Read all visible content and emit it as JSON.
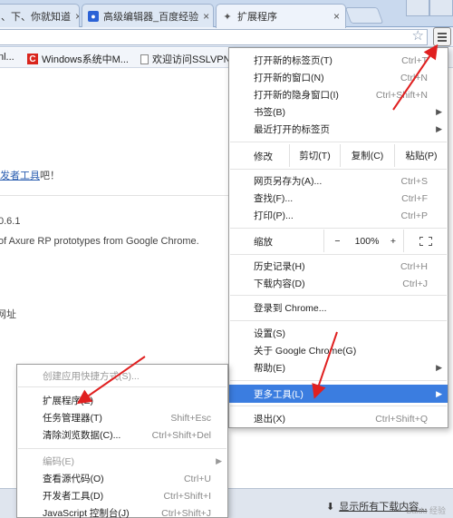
{
  "tabs": [
    {
      "label": "、下、你就知道",
      "active": false
    },
    {
      "label": "高级编辑器_百度经验",
      "active": false
    },
    {
      "label": "扩展程序",
      "active": true
    }
  ],
  "tab_close": "×",
  "bookmarks": [
    {
      "label": "nl..."
    },
    {
      "label": "Windows系统中M..."
    },
    {
      "label": "欢迎访问SSLVPN"
    }
  ],
  "page": {
    "line1_link": "发者工具",
    "line1_tail": "吧！",
    "version": "0.6.1",
    "desc": "of Axure RP prototypes from Google Chrome.",
    "addr": "网址"
  },
  "menu": {
    "items_top": [
      {
        "label": "打开新的标签页(T)",
        "shortcut": "Ctrl+T"
      },
      {
        "label": "打开新的窗口(N)",
        "shortcut": "Ctrl+N"
      },
      {
        "label": "打开新的隐身窗口(I)",
        "shortcut": "Ctrl+Shift+N"
      },
      {
        "label": "书签(B)",
        "arrow": "▶"
      },
      {
        "label": "最近打开的标签页",
        "arrow": "▶"
      }
    ],
    "edit": {
      "label": "修改",
      "cut": "剪切(T)",
      "copy": "复制(C)",
      "paste": "粘贴(P)"
    },
    "items_mid": [
      {
        "label": "网页另存为(A)...",
        "shortcut": "Ctrl+S"
      },
      {
        "label": "查找(F)...",
        "shortcut": "Ctrl+F"
      },
      {
        "label": "打印(P)...",
        "shortcut": "Ctrl+P"
      }
    ],
    "zoom": {
      "label": "缩放",
      "minus": "−",
      "value": "100%",
      "plus": "+"
    },
    "items_hist": [
      {
        "label": "历史记录(H)",
        "shortcut": "Ctrl+H"
      },
      {
        "label": "下载内容(D)",
        "shortcut": "Ctrl+J"
      }
    ],
    "signin": "登录到 Chrome...",
    "items_settings": [
      {
        "label": "设置(S)"
      },
      {
        "label": "关于 Google Chrome(G)"
      },
      {
        "label": "帮助(E)",
        "arrow": "▶"
      }
    ],
    "more_tools": {
      "label": "更多工具(L)",
      "arrow": "▶"
    },
    "exit": {
      "label": "退出(X)",
      "shortcut": "Ctrl+Shift+Q"
    }
  },
  "submenu": {
    "items": [
      {
        "label": "创建应用快捷方式(S)...",
        "shortcut": "",
        "disabled": true
      },
      {
        "label": "扩展程序(E)",
        "shortcut": ""
      },
      {
        "label": "任务管理器(T)",
        "shortcut": "Shift+Esc"
      },
      {
        "label": "清除浏览数据(C)...",
        "shortcut": "Ctrl+Shift+Del"
      },
      {
        "label": "编码(E)",
        "shortcut": "",
        "disabled": true,
        "arrow": "▶"
      },
      {
        "label": "查看源代码(O)",
        "shortcut": "Ctrl+U"
      },
      {
        "label": "开发者工具(D)",
        "shortcut": "Ctrl+Shift+I"
      },
      {
        "label": "JavaScript 控制台(J)",
        "shortcut": "Ctrl+Shift+J"
      }
    ]
  },
  "downloads": {
    "label": "显示所有下载内容..."
  },
  "watermark": "Baidu 经验",
  "colors": {
    "accent": "#3b7de0",
    "annotation": "#e02020"
  }
}
